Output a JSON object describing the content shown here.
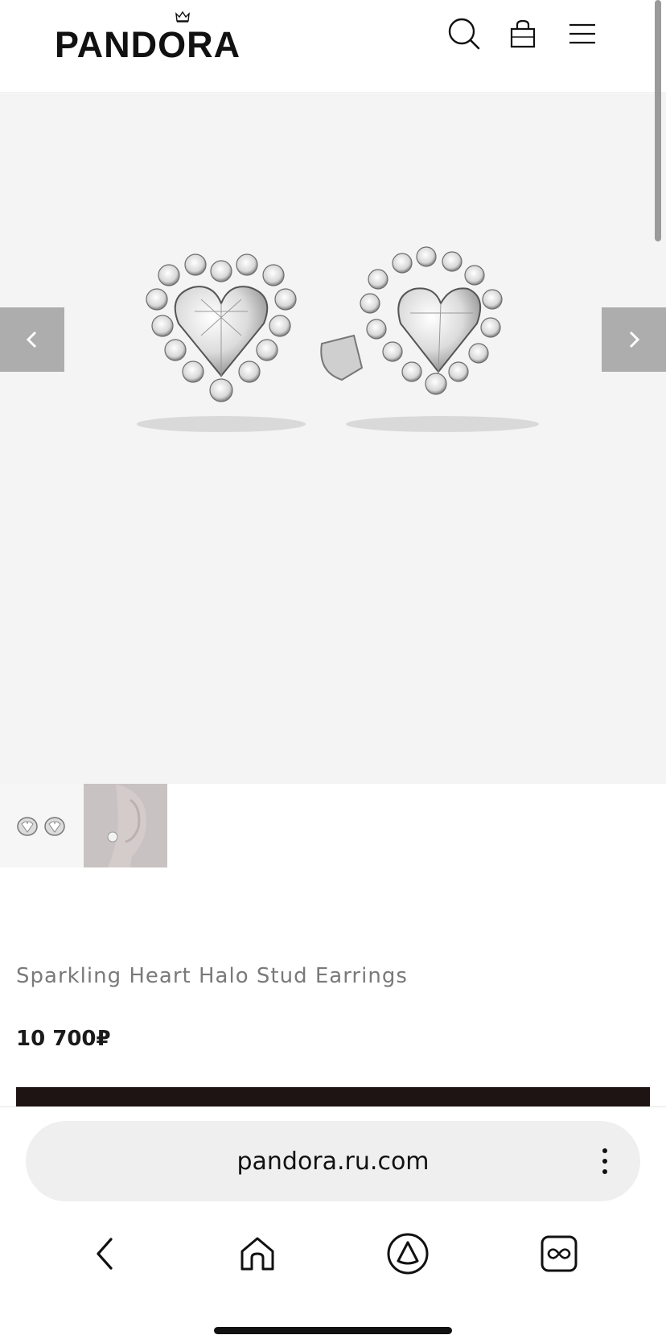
{
  "header": {
    "brand": "PANDORA",
    "icons": [
      "search-icon",
      "bag-icon",
      "hamburger-menu-icon"
    ]
  },
  "gallery": {
    "image_alt": "Sparkling Heart Halo Stud Earrings",
    "prev_icon": "chevron-left-icon",
    "next_icon": "chevron-right-icon",
    "thumbnails": [
      "earrings-pair-thumbnail",
      "model-ear-thumbnail"
    ]
  },
  "product": {
    "title": "Sparkling Heart Halo Stud Earrings",
    "price": "10 700₽"
  },
  "browser": {
    "url": "pandora.ru.com",
    "menu_icon": "more-vertical-icon",
    "nav": [
      "back-icon",
      "home-icon",
      "assistant-icon",
      "tabs-icon"
    ]
  },
  "colors": {
    "brand_text": "#111111",
    "gallery_bg": "#f4f4f4",
    "arrow_bg": "#adadad",
    "cta_bg": "#1f1414",
    "title_gray": "#7a7a7a"
  }
}
